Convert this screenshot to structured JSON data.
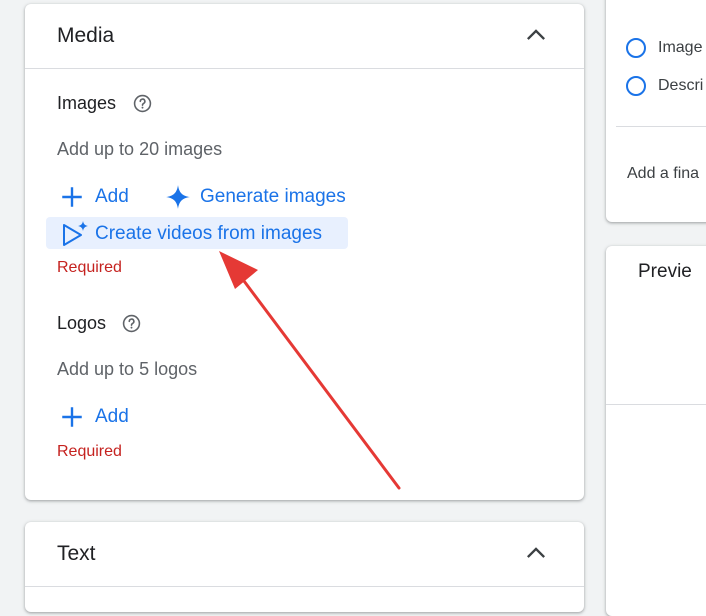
{
  "media": {
    "title": "Media",
    "images": {
      "label": "Images",
      "hint": "Add up to 20 images",
      "add_label": "Add",
      "generate_label": "Generate images",
      "create_videos_label": "Create videos from images",
      "required_label": "Required"
    },
    "logos": {
      "label": "Logos",
      "hint": "Add up to 5 logos",
      "add_label": "Add",
      "required_label": "Required"
    }
  },
  "text_card": {
    "title": "Text"
  },
  "right_panel": {
    "options": [
      "Image",
      "Descri"
    ],
    "final_text": "Add a fina"
  },
  "preview": {
    "title": "Previe"
  },
  "colors": {
    "accent": "#1a73e8",
    "required": "#c5221f",
    "annotation": "#e53935",
    "highlight": "#e8f0fe"
  }
}
